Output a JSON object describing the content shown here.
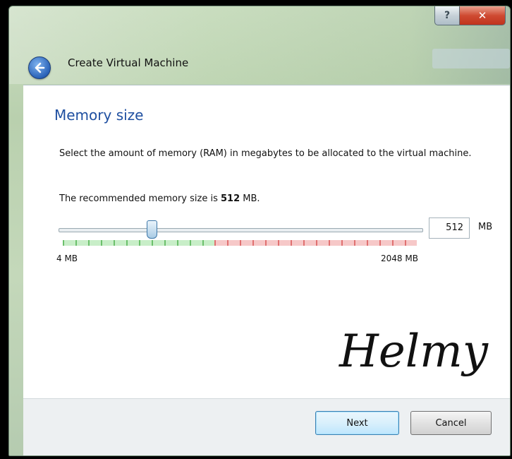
{
  "window": {
    "title": "Create Virtual Machine",
    "help_glyph": "?",
    "close_glyph": "✕"
  },
  "page": {
    "title": "Memory size",
    "description": "Select the amount of memory (RAM) in megabytes to be allocated to the virtual machine.",
    "recommendation_prefix": "The recommended memory size is ",
    "recommended_value": "512",
    "recommendation_suffix": " MB."
  },
  "memory_slider": {
    "min_label": "4 MB",
    "max_label": "2048 MB",
    "min_mb": 4,
    "max_mb": 2048,
    "value_mb": 512
  },
  "memory_input": {
    "value": "512",
    "unit": "MB"
  },
  "signature": "Helmy",
  "footer": {
    "next_label": "Next",
    "cancel_label": "Cancel"
  },
  "colors": {
    "title_blue": "#1f4fa0",
    "recommended_green": "#6cc06c",
    "over_red": "#e07070",
    "close_red": "#c0331d"
  },
  "icons": {
    "back": "back-arrow-icon",
    "help": "help-icon",
    "close": "close-icon"
  }
}
